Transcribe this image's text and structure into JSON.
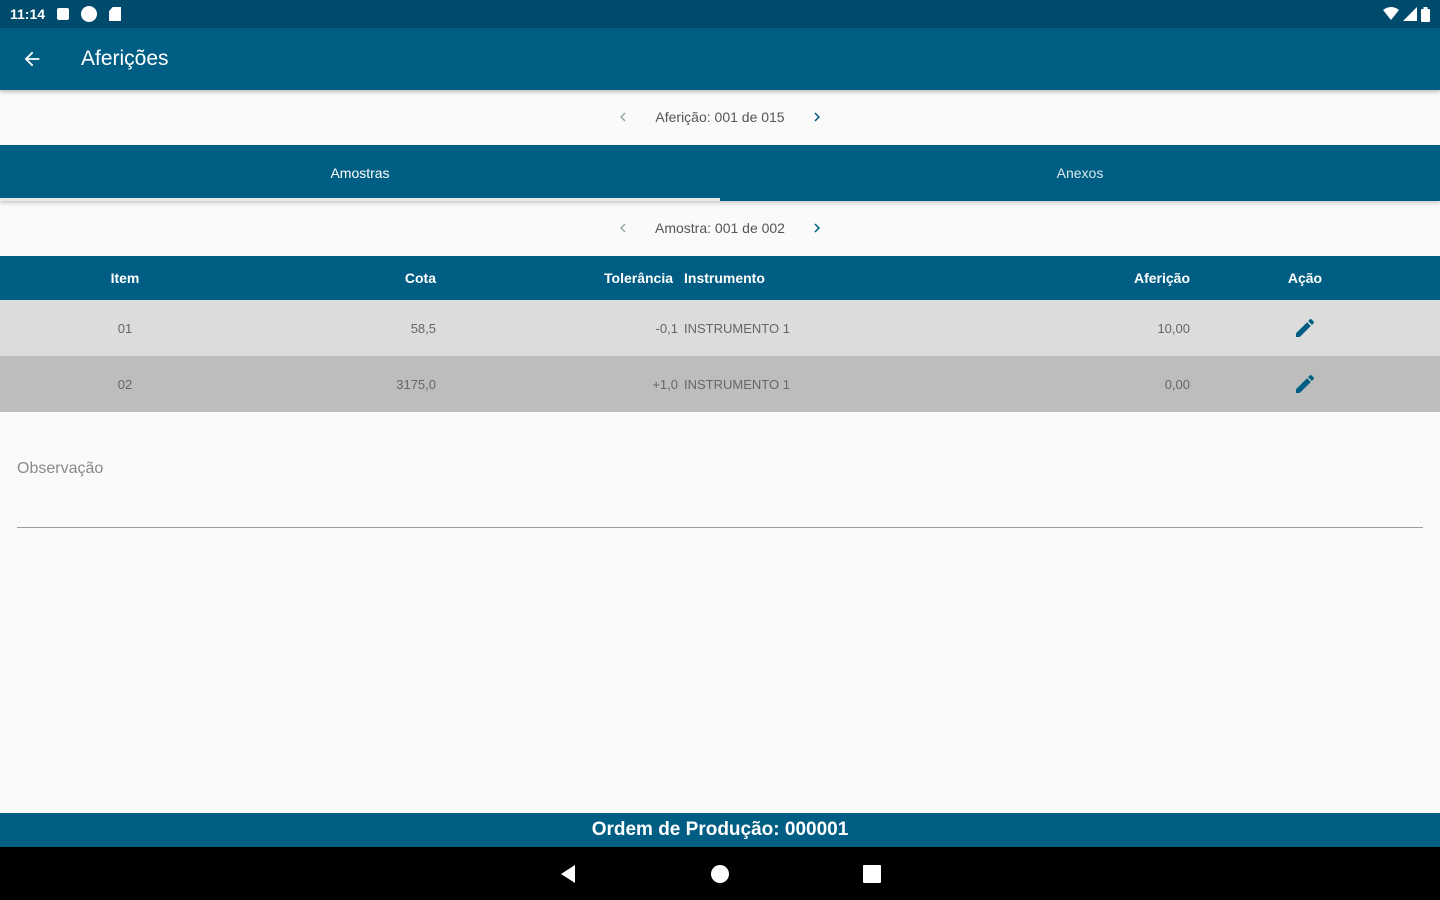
{
  "status_bar": {
    "time": "11:14"
  },
  "app_bar": {
    "title": "Aferições"
  },
  "afericao_pager": {
    "label": "Aferição: 001 de 015"
  },
  "tabs": [
    {
      "label": "Amostras",
      "active": true
    },
    {
      "label": "Anexos",
      "active": false
    }
  ],
  "amostra_pager": {
    "label": "Amostra: 001 de 002"
  },
  "table": {
    "headers": {
      "item": "Item",
      "cota": "Cota",
      "tolerancia": "Tolerância",
      "instrumento": "Instrumento",
      "afericao": "Aferição",
      "acao": "Ação"
    },
    "rows": [
      {
        "item": "01",
        "cota": "58,5",
        "tolerancia": "-0,1",
        "instrumento": "INSTRUMENTO 1",
        "afericao": "10,00"
      },
      {
        "item": "02",
        "cota": "3175,0",
        "tolerancia": "+1,0",
        "instrumento": "INSTRUMENTO 1",
        "afericao": "0,00"
      }
    ]
  },
  "observacao": {
    "placeholder": "Observação",
    "value": ""
  },
  "footer": {
    "text": "Ordem de Produção: 000001"
  },
  "colors": {
    "primary": "#005e84",
    "status_bar": "#004a6b",
    "row_odd": "#dcdcdc",
    "row_even": "#bdbdbd",
    "edit_icon": "#005e84"
  },
  "icons": {
    "back": "arrow-left-icon",
    "prev": "chevron-left-icon",
    "next": "chevron-right-icon",
    "edit": "pencil-icon"
  }
}
